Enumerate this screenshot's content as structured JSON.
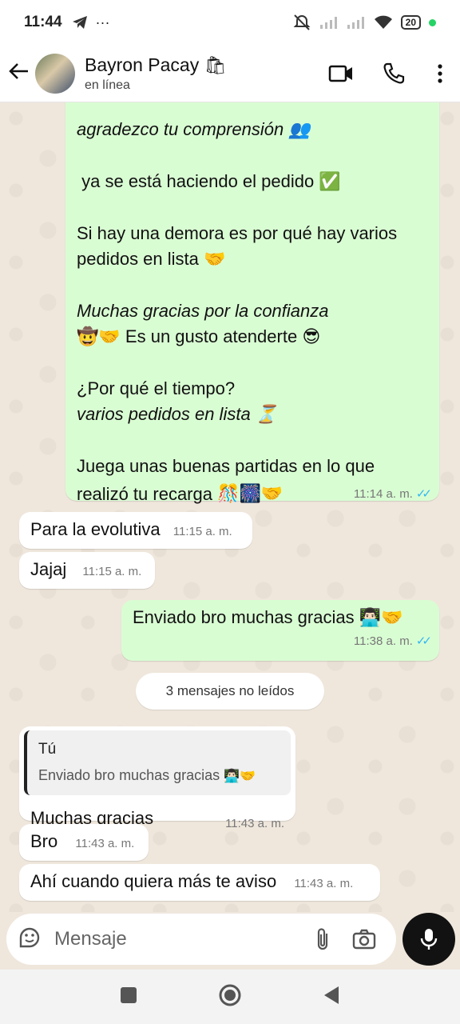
{
  "status_bar": {
    "time": "11:44",
    "battery": "20",
    "icons": [
      "telegram-icon",
      "more-dots-icon",
      "mute-icon",
      "signal-icon",
      "signal-icon",
      "wifi-icon",
      "battery-icon"
    ]
  },
  "header": {
    "contact_name": "Bayron Pacay",
    "contact_emoji": "🛍",
    "contact_status": "en línea",
    "icons": [
      "back-arrow-icon",
      "video-call-icon",
      "phone-icon",
      "more-vert-icon"
    ]
  },
  "messages": {
    "long_out": {
      "l1": "agradezco tu comprensión",
      "l1_emoji": "👥",
      "l2": "ya se está haciendo el pedido",
      "l2_emoji": "✅",
      "l3": "Si hay una demora es por qué hay varios",
      "l4": "pedidos en lista",
      "l4_emoji": "🤝",
      "l5": "Muchas gracias por la confianza",
      "l6_emoji_a": "🤠🤝",
      "l6": "Es un gusto atenderte",
      "l6_emoji_b": "😎",
      "l7": "¿Por qué el tiempo?",
      "l8": "varios pedidos en lista",
      "l8_emoji": "⏳",
      "l9": "Juega unas buenas partidas en lo que",
      "l10": "realizó tu recarga",
      "l10_emoji": "🎊🎆🤝",
      "time": "11:14 a. m."
    },
    "in1": {
      "text": "Para la evolutiva",
      "time": "11:15 a. m."
    },
    "in2": {
      "text": "Jajaj",
      "time": "11:15 a. m."
    },
    "out2": {
      "text": "Enviado bro muchas gracias",
      "emoji": "👨🏻‍💻🤝",
      "time": "11:38 a. m."
    },
    "unread_pill": "3 mensajes no leídos",
    "in3": {
      "quote_author": "Tú",
      "quote_text": "Enviado bro muchas gracias",
      "quote_emoji": "👨🏻‍💻🤝",
      "text": "Muchas gracias",
      "time": "11:43 a. m."
    },
    "in4": {
      "text": "Bro",
      "time": "11:43 a. m."
    },
    "in5": {
      "text": "Ahí cuando quiera más te aviso",
      "time": "11:43 a. m."
    }
  },
  "composer": {
    "placeholder": "Mensaje",
    "icons": [
      "sticker-icon",
      "attach-icon",
      "camera-icon",
      "mic-icon"
    ]
  },
  "nav": {
    "icons": [
      "recent-apps-icon",
      "home-icon",
      "back-icon"
    ]
  },
  "colors": {
    "outgoing": "#d9fdd3",
    "incoming": "#ffffff",
    "read_ticks": "#34b7f1",
    "background": "#efe7dc"
  }
}
